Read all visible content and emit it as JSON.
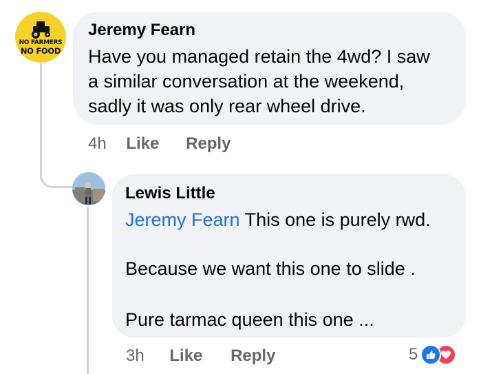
{
  "comment": {
    "author": "Jeremy Fearn",
    "lines": [
      "Have you managed retain the 4wd? I saw",
      "a similar conversation at the weekend,",
      "sadly it was only rear wheel drive."
    ],
    "time": "4h",
    "like_label": "Like",
    "reply_label": "Reply",
    "avatar": {
      "line1": "NO FARMERS",
      "line2": "NO FOOD",
      "icon": "tractor-icon",
      "bg_color": "#f5d12a"
    }
  },
  "reply": {
    "author": "Lewis Little",
    "mention": "Jeremy Fearn",
    "line1_rest": " This one is purely rwd.",
    "line2": "Because we want this one to slide .",
    "line3": "Pure tarmac queen this one ...",
    "time": "3h",
    "like_label": "Like",
    "reply_label": "Reply",
    "reaction_count": "5",
    "reactions": [
      "like-reaction-icon",
      "love-reaction-icon"
    ],
    "avatar_icon": "profile-photo"
  },
  "colors": {
    "bubble": "#f0f2f5",
    "mention": "#1d6fd8",
    "meta": "#65676b",
    "like": "#1877f2",
    "love": "#f33e58"
  }
}
